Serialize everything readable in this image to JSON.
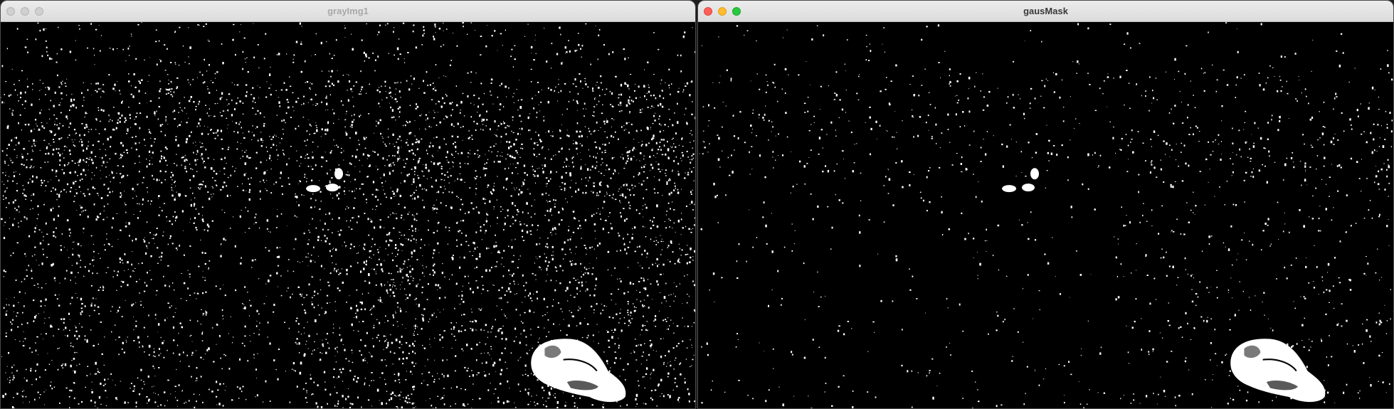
{
  "windows": [
    {
      "title": "grayImg1",
      "state": "inactive",
      "content": "binary-mask-dense-noise"
    },
    {
      "title": "gausMask",
      "state": "active",
      "content": "binary-mask-sparse-noise"
    }
  ],
  "colors": {
    "titlebar": "#e4e4e4",
    "close": "#ff5f57",
    "minimize": "#febc2e",
    "zoom": "#28c840",
    "mask_foreground": "#ffffff",
    "mask_background": "#000000"
  }
}
